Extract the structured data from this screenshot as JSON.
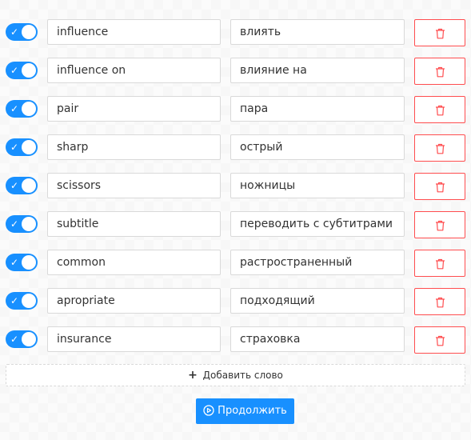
{
  "words": [
    {
      "enabled": true,
      "term": "influence",
      "translation": "влиять"
    },
    {
      "enabled": true,
      "term": "influence on",
      "translation": "влияние на"
    },
    {
      "enabled": true,
      "term": "pair",
      "translation": "пара"
    },
    {
      "enabled": true,
      "term": "sharp",
      "translation": "острый"
    },
    {
      "enabled": true,
      "term": "scissors",
      "translation": "ножницы"
    },
    {
      "enabled": true,
      "term": "subtitle",
      "translation": "переводить с субтитрами"
    },
    {
      "enabled": true,
      "term": "common",
      "translation": "растространенный"
    },
    {
      "enabled": true,
      "term": "apropriate",
      "translation": "подходящий"
    },
    {
      "enabled": true,
      "term": "insurance",
      "translation": "страховка"
    }
  ],
  "add_button": {
    "label": "Добавить слово",
    "icon": "plus-icon"
  },
  "continue_button": {
    "label": "Продолжить",
    "icon": "play-circle-icon"
  },
  "colors": {
    "primary": "#1890ff",
    "danger": "#ff4d4f"
  }
}
